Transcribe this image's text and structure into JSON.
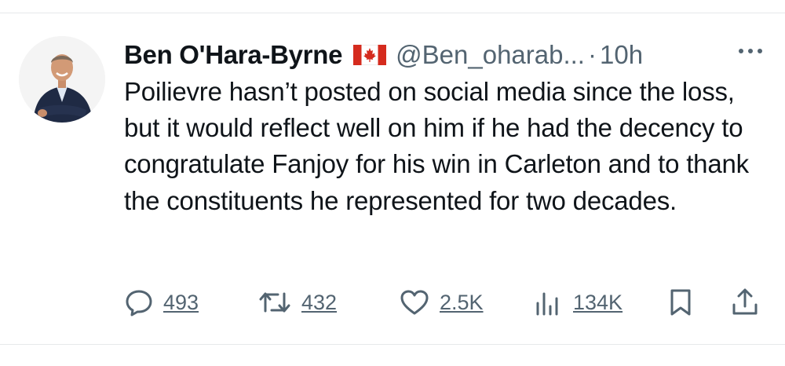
{
  "tweet": {
    "author_name": "Ben O'Hara-Byrne",
    "handle": "@Ben_oharab...",
    "separator": "·",
    "time": "10h",
    "text": "Poilievre hasn’t posted on social media since the loss, but it would reflect well on him if he had the decency to congratulate Fanjoy for his win in Carleton and to thank the constituents he represented for two decades.",
    "flag_icon": "canada-flag-icon"
  },
  "actions": {
    "replies": "493",
    "reposts": "432",
    "likes": "2.5K",
    "views": "134K"
  },
  "colors": {
    "text": "#0f1419",
    "secondary": "#536471",
    "divider": "#e7e9ea",
    "flag_red": "#d52b1e"
  }
}
